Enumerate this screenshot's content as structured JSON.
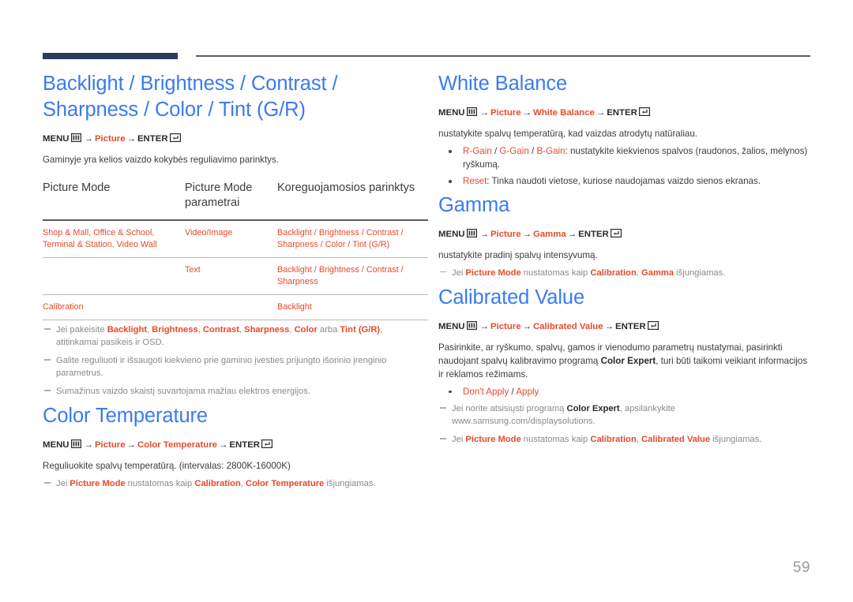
{
  "page": {
    "number": "59",
    "accent_blue": "#3a7bef",
    "accent_orange": "#e8492b",
    "rule_navy": "#2c3a5c"
  },
  "icons": {
    "menu": "menu-grid-icon",
    "enter": "enter-return-icon"
  },
  "left": {
    "section1": {
      "heading": "Backlight / Brightness / Contrast / Sharpness / Color / Tint (G/R)",
      "menupath": {
        "menu": "MENU",
        "arrow": "→",
        "step1": "Picture",
        "enter": "ENTER"
      },
      "intro": "Gaminyje yra kelios vaizdo kokybės reguliavimo parinktys.",
      "table": {
        "headers": [
          "Picture Mode",
          "Picture Mode parametrai",
          "Koreguojamosios parinktys"
        ],
        "rows": [
          {
            "mode": "Shop & Mall, Office & School, Terminal & Station, Video Wall",
            "params": "Video/Image",
            "options_parts": [
              "Backlight",
              " / ",
              "Brightness",
              " / ",
              "Contrast",
              " / ",
              "Sharpness",
              " / ",
              "Color",
              " / ",
              "Tint (G/R)"
            ]
          },
          {
            "mode": "",
            "params": "Text",
            "options_parts": [
              "Backlight",
              " / ",
              "Brightness",
              " / ",
              "Contrast",
              " / ",
              "Sharpness"
            ]
          },
          {
            "mode": "Calibration",
            "params": "",
            "options_parts": [
              "Backlight"
            ]
          }
        ]
      },
      "notes": [
        {
          "parts": [
            {
              "t": "Jei pakeisite ",
              "s": "plain"
            },
            {
              "t": "Backlight",
              "s": "hl"
            },
            {
              "t": ", ",
              "s": "plain"
            },
            {
              "t": "Brightness",
              "s": "hl"
            },
            {
              "t": ", ",
              "s": "plain"
            },
            {
              "t": "Contrast",
              "s": "hl"
            },
            {
              "t": ", ",
              "s": "plain"
            },
            {
              "t": "Sharpness",
              "s": "hl"
            },
            {
              "t": ", ",
              "s": "plain"
            },
            {
              "t": "Color",
              "s": "hl"
            },
            {
              "t": " arba ",
              "s": "plain"
            },
            {
              "t": "Tint (G/R)",
              "s": "hl"
            },
            {
              "t": ", atitinkamai pasikeis ir OSD.",
              "s": "plain"
            }
          ]
        },
        {
          "parts": [
            {
              "t": "Galite reguliuoti ir išsaugoti kiekvieno prie gaminio įvesties prijungto išorinio įrenginio parametrus.",
              "s": "plain"
            }
          ]
        },
        {
          "parts": [
            {
              "t": "Sumažinus vaizdo skaistį suvartojama mažiau elektros energijos.",
              "s": "plain"
            }
          ]
        }
      ]
    },
    "section2": {
      "heading": "Color Temperature",
      "menupath": {
        "menu": "MENU",
        "arrow": "→",
        "step1": "Picture",
        "step2": "Color Temperature",
        "enter": "ENTER"
      },
      "intro": "Reguliuokite spalvų temperatūrą. (intervalas: 2800K-16000K)",
      "notes": [
        {
          "parts": [
            {
              "t": "Jei ",
              "s": "plain"
            },
            {
              "t": "Picture Mode",
              "s": "hl"
            },
            {
              "t": " nustatomas kaip ",
              "s": "plain"
            },
            {
              "t": "Calibration",
              "s": "hl"
            },
            {
              "t": ", ",
              "s": "plain"
            },
            {
              "t": "Color Temperature",
              "s": "hl"
            },
            {
              "t": " išjungiamas.",
              "s": "plain"
            }
          ]
        }
      ]
    }
  },
  "right": {
    "section1": {
      "heading": "White Balance",
      "menupath": {
        "menu": "MENU",
        "arrow": "→",
        "step1": "Picture",
        "step2": "White Balance",
        "enter": "ENTER"
      },
      "intro": "nustatykite spalvų temperatūrą, kad vaizdas atrodytų natūraliau.",
      "bullets": [
        {
          "parts": [
            {
              "t": "R-Gain",
              "s": "hl"
            },
            {
              "t": " / ",
              "s": "plain"
            },
            {
              "t": "G-Gain",
              "s": "hl"
            },
            {
              "t": " / ",
              "s": "plain"
            },
            {
              "t": "B-Gain",
              "s": "hl"
            },
            {
              "t": ": nustatykite kiekvienos spalvos (raudonos, žalios, mėlynos) ryškumą.",
              "s": "plain"
            }
          ]
        },
        {
          "parts": [
            {
              "t": "Reset",
              "s": "hl"
            },
            {
              "t": ": Tinka naudoti vietose, kuriose naudojamas vaizdo sienos ekranas.",
              "s": "plain"
            }
          ]
        }
      ]
    },
    "section2": {
      "heading": "Gamma",
      "menupath": {
        "menu": "MENU",
        "arrow": "→",
        "step1": "Picture",
        "step2": "Gamma",
        "enter": "ENTER"
      },
      "intro": "nustatykite pradinį spalvų intensyvumą.",
      "notes": [
        {
          "parts": [
            {
              "t": "Jei ",
              "s": "plain"
            },
            {
              "t": "Picture Mode",
              "s": "hl"
            },
            {
              "t": " nustatomas kaip ",
              "s": "plain"
            },
            {
              "t": "Calibration",
              "s": "hl"
            },
            {
              "t": ", ",
              "s": "plain"
            },
            {
              "t": "Gamma",
              "s": "hl"
            },
            {
              "t": " išjungiamas.",
              "s": "plain"
            }
          ]
        }
      ]
    },
    "section3": {
      "heading": "Calibrated Value",
      "menupath": {
        "menu": "MENU",
        "arrow": "→",
        "step1": "Picture",
        "step2": "Calibrated Value",
        "enter": "ENTER"
      },
      "intro_parts": [
        {
          "t": "Pasirinkite, ar ryškumo, spalvų, gamos ir vienodumo parametrų nustatymai, pasirinkti naudojant spalvų kalibravimo programą ",
          "s": "plain"
        },
        {
          "t": "Color Expert",
          "s": "b"
        },
        {
          "t": ", turi būti taikomi veikiant informacijos ir reklamos režimams.",
          "s": "plain"
        }
      ],
      "bullets": [
        {
          "parts": [
            {
              "t": "Don't Apply",
              "s": "hl"
            },
            {
              "t": " / ",
              "s": "plain"
            },
            {
              "t": "Apply",
              "s": "hl"
            }
          ]
        }
      ],
      "notes": [
        {
          "parts": [
            {
              "t": "Jei norite atsisiųsti programą ",
              "s": "plain"
            },
            {
              "t": "Color Expert",
              "s": "b"
            },
            {
              "t": ", apsilankykite www.samsung.com/displaysolutions.",
              "s": "plain"
            }
          ]
        },
        {
          "parts": [
            {
              "t": "Jei ",
              "s": "plain"
            },
            {
              "t": "Picture Mode",
              "s": "hl"
            },
            {
              "t": " nustatomas kaip ",
              "s": "plain"
            },
            {
              "t": "Calibration",
              "s": "hl"
            },
            {
              "t": ", ",
              "s": "plain"
            },
            {
              "t": "Calibrated Value",
              "s": "hl"
            },
            {
              "t": " išjungiamas.",
              "s": "plain"
            }
          ]
        }
      ]
    }
  }
}
